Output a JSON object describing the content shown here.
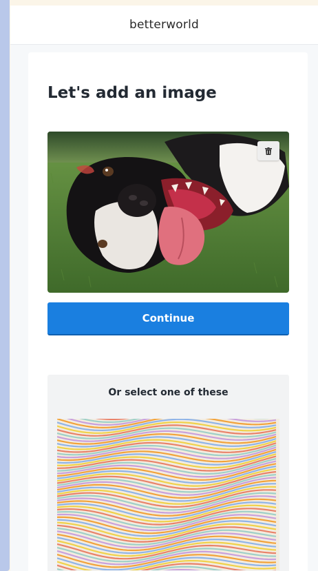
{
  "app": {
    "brand": "betterworld"
  },
  "page": {
    "title": "Let's add an image"
  },
  "uploaded_image": {
    "subject": "dog",
    "delete_icon": "trash-icon"
  },
  "actions": {
    "continue_label": "Continue"
  },
  "alternatives": {
    "heading": "Or select one of these",
    "options": [
      {
        "subject": "wavy-stripes-pattern"
      }
    ]
  },
  "colors": {
    "accent": "#1a7fe0",
    "background": "#f6f8fa",
    "side_panel": "#b9c8ea"
  }
}
